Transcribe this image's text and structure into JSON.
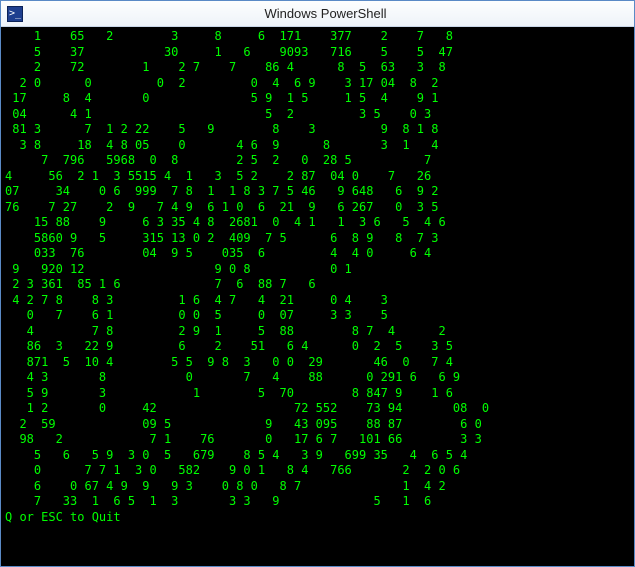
{
  "window": {
    "icon_glyph": ">_",
    "title": "Windows PowerShell"
  },
  "terminal": {
    "lines": [
      "    1    65   2        3     8     6  171    377    2    7   8",
      "    5    37           30     1   6    9093   716    5    5  47",
      "    2    72        1    2 7    7    86 4      8  5  63   3  8",
      "  2 0      0         0  2         0  4  6 9    3 17 04  8  2",
      " 17     8  4       0              5 9  1 5     1 5  4    9 1",
      " 04      4 1                        5  2         3 5    0 3",
      " 81 3      7  1 2 22    5   9        8    3         9  8 1 8",
      "  3 8     18  4 8 05    0       4 6  9      8       3  1   4",
      "     7  796   5968  0  8        2 5  2   0  28 5          7",
      "4     56  2 1  3 5515 4  1   3  5 2    2 87  04 0    7   26",
      "07     34    0 6  999  7 8  1  1 8 3 7 5 46   9 648   6  9 2",
      "76    7 27    2  9   7 4 9  6 1 0  6  21  9   6 267   0  3 5",
      "    15 88    9     6 3 35 4 8  2681  0  4 1   1  3 6   5  4 6",
      "    5860 9   5     315 13 0 2  409  7 5      6  8 9   8  7 3",
      "    033  76        04  9 5    035  6         4  4 0     6 4",
      " 9   920 12                  9 0 8           0 1",
      " 2 3 361  85 1 6             7  6  88 7   6",
      " 4 2 7 8    8 3         1 6  4 7   4  21     0 4    3",
      "   0   7    6 1         0 0  5     0  07     3 3    5",
      "   4        7 8         2 9  1     5  88        8 7  4      2",
      "   86  3   22 9         6    2    51   6 4      0  2  5    3 5",
      "   871  5  10 4        5 5  9 8  3   0 0  29       46  0   7 4",
      "   4 3       8           0       7   4    88      0 291 6   6 9",
      "   5 9       3            1        5  70        8 847 9    1 6",
      "   1 2       0     42                   72 552    73 94       08  0",
      "  2  59            09 5             9   43 095    88 87        6 0",
      "  98   2            7 1    76       0   17 6 7   101 66        3 3",
      "    5   6   5 9  3 0  5   679    8 5 4   3 9   699 35   4  6 5 4",
      "    0      7 7 1  3 0   582    9 0 1   8 4   766       2  2 0 6",
      "    6    0 67 4 9  9   9 3    0 8 0   8 7              1  4 2",
      "    7   33  1  6 5  1  3       3 3   9             5   1  6",
      "Q or ESC to Quit"
    ]
  }
}
